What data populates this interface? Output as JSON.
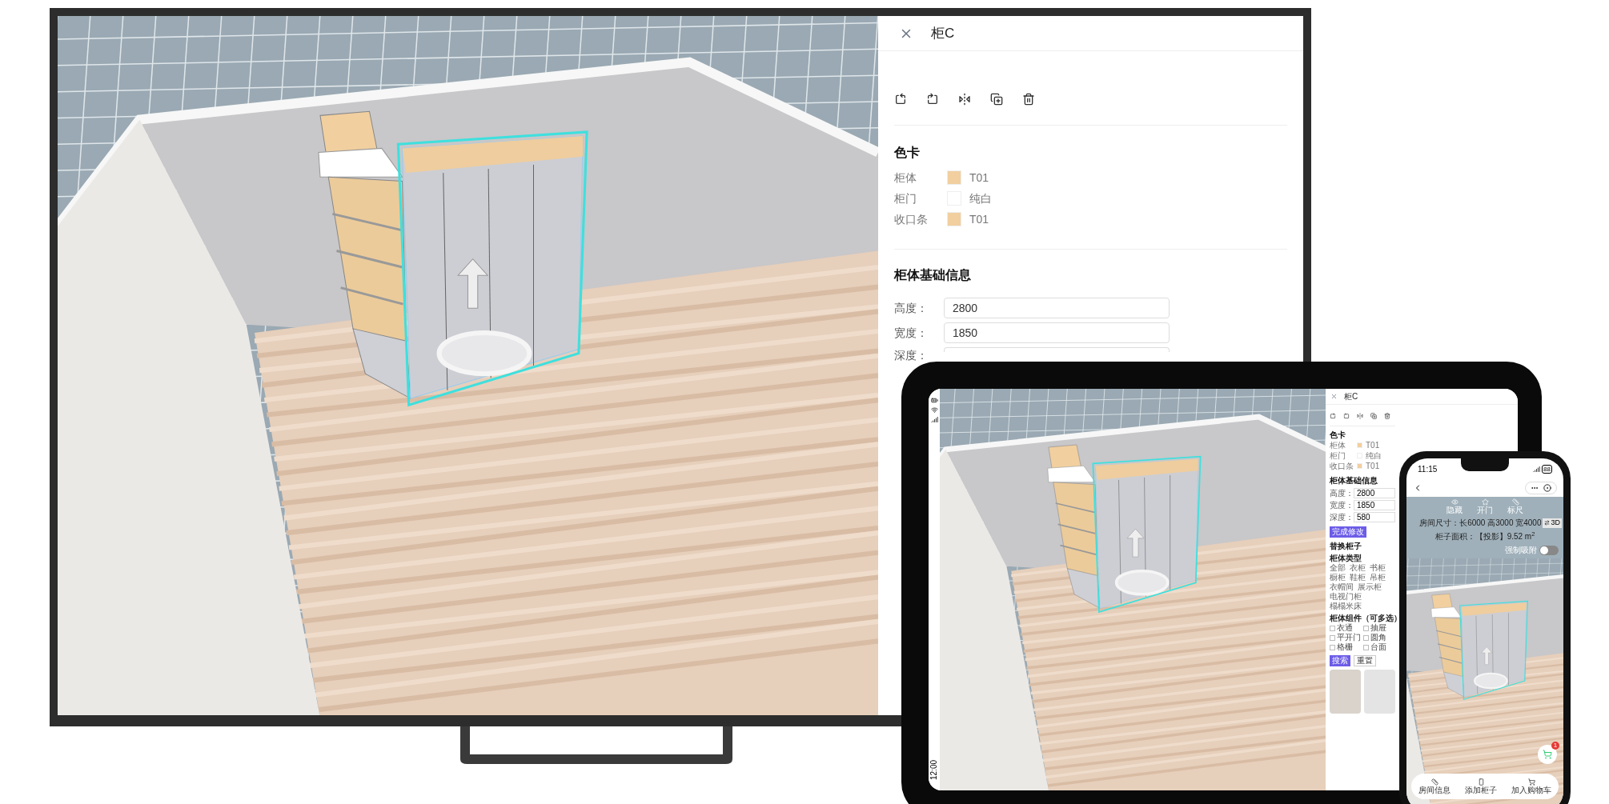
{
  "tv": {
    "panel": {
      "title": "柜C",
      "color_card": {
        "heading": "色卡",
        "rows": [
          {
            "label": "柜体",
            "color": "#f1cf9f",
            "value": "T01"
          },
          {
            "label": "柜门",
            "color": "#ffffff",
            "value": "纯白"
          },
          {
            "label": "收口条",
            "color": "#f1cf9f",
            "value": "T01"
          }
        ]
      },
      "basic_info": {
        "heading": "柜体基础信息",
        "fields": [
          {
            "label": "高度：",
            "value": "2800"
          },
          {
            "label": "宽度：",
            "value": "1850"
          },
          {
            "label": "深度："
          }
        ]
      }
    }
  },
  "tablet": {
    "status_bar": {
      "time": "12:00"
    },
    "panel": {
      "title": "柜C",
      "color_card": {
        "heading": "色卡",
        "rows": [
          {
            "label": "柜体",
            "color": "#f1cf9f",
            "value": "T01"
          },
          {
            "label": "柜门",
            "color": "#ffffff",
            "value": "纯白"
          },
          {
            "label": "收口条",
            "color": "#f1cf9f",
            "value": "T01"
          }
        ]
      },
      "basic_info": {
        "heading": "柜体基础信息",
        "fields": [
          {
            "label": "高度：",
            "value": "2800"
          },
          {
            "label": "宽度：",
            "value": "1850"
          },
          {
            "label": "深度：",
            "value": "580"
          }
        ]
      },
      "done_button": "完成修改",
      "replace": {
        "heading": "替换柜子",
        "type_label": "柜体类型",
        "types": [
          "全部",
          "衣柜",
          "书柜",
          "橱柜",
          "鞋柜",
          "吊柜",
          "衣帽间",
          "展示柜",
          "电视门柜",
          "榻榻米床"
        ],
        "components_label": "柜体组件（可多选）",
        "components": [
          {
            "label": "衣通",
            "checked": false
          },
          {
            "label": "抽屉",
            "checked": false
          },
          {
            "label": "平开门",
            "checked": false
          },
          {
            "label": "圆角",
            "checked": false
          },
          {
            "label": "格栅",
            "checked": false
          },
          {
            "label": "台面",
            "checked": false
          }
        ],
        "buttons": [
          {
            "label": "搜索",
            "kind": "primary"
          },
          {
            "label": "重置",
            "kind": "default"
          }
        ]
      }
    }
  },
  "phone": {
    "status_bar": {
      "time": "11:15",
      "battery": "88"
    },
    "toolbar": [
      {
        "label": "隐藏",
        "kind": "eye"
      },
      {
        "label": "开门",
        "kind": "door"
      },
      {
        "label": "标尺",
        "kind": "ruler"
      }
    ],
    "room_size": "房间尺寸：长6000 高3000 宽4000",
    "view_toggle": "3D",
    "area": "柜子面积：【投影】9.52 m$^{2}$",
    "snap": {
      "label": "强制吸附",
      "on": false
    },
    "cart_badge": "1",
    "bottom_nav": [
      {
        "label": "房间信息",
        "kind": "ruler"
      },
      {
        "label": "添加柜子",
        "kind": "cabinet"
      },
      {
        "label": "加入购物车",
        "kind": "cart"
      }
    ]
  }
}
